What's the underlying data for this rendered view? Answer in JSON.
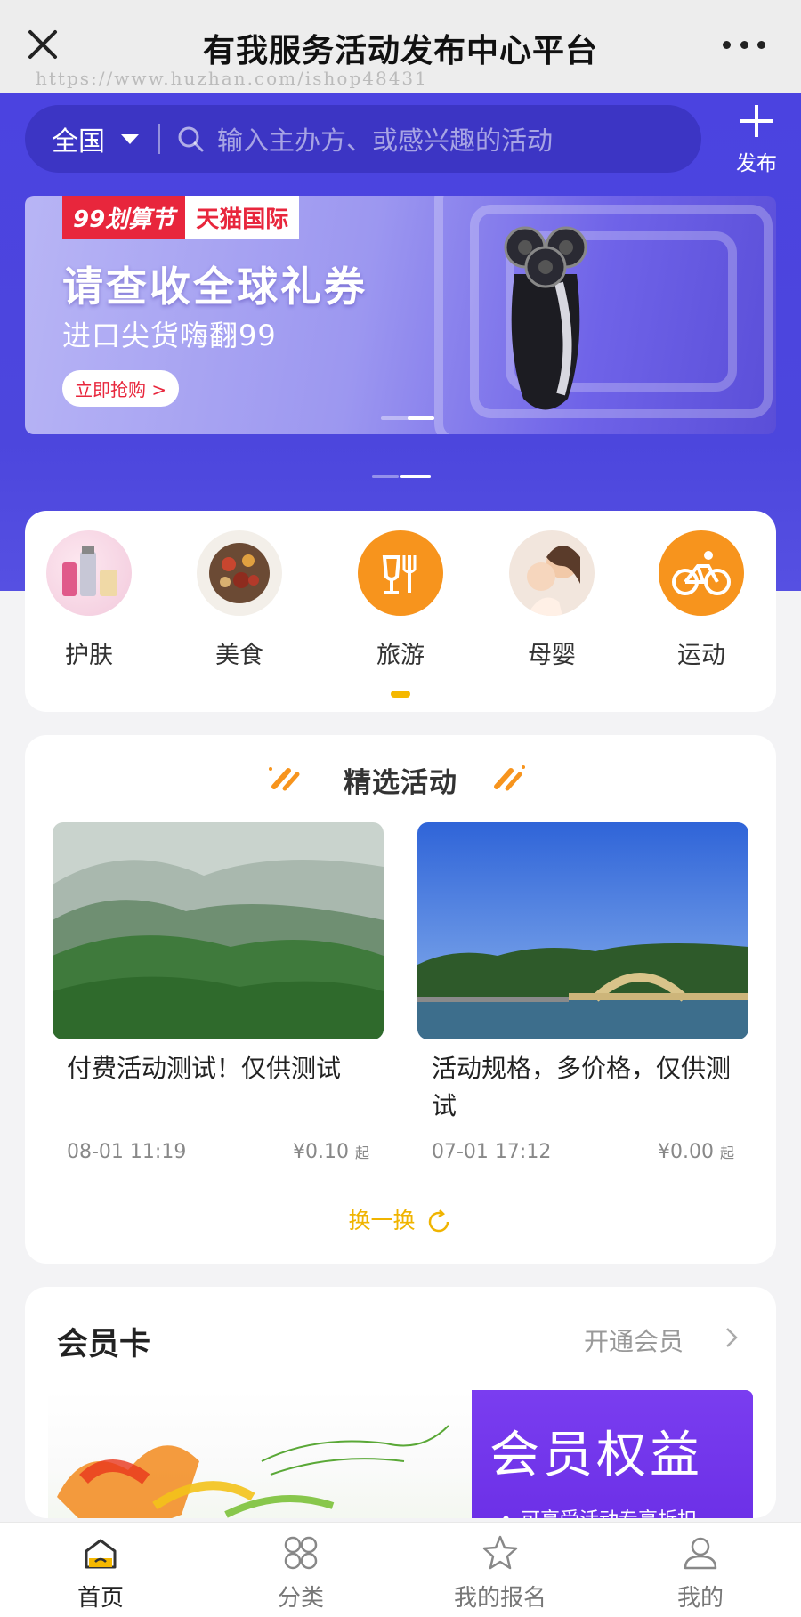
{
  "window": {
    "title": "有我服务活动发布中心平台",
    "watermark": "https://www.huzhan.com/ishop48431"
  },
  "search": {
    "region": "全国",
    "placeholder": "输入主办方、或感兴趣的活动",
    "publish_label": "发布"
  },
  "banner": {
    "tag_festival": "99划算节",
    "tag_brand": "天猫国际",
    "headline": "请查收全球礼券",
    "subline": "进口尖货嗨翻99",
    "button": "立即抢购 >"
  },
  "categories": [
    {
      "label": "护肤",
      "icon": "skincare-icon"
    },
    {
      "label": "美食",
      "icon": "food-icon"
    },
    {
      "label": "旅游",
      "icon": "travel-icon"
    },
    {
      "label": "母婴",
      "icon": "mother-baby-icon"
    },
    {
      "label": "运动",
      "icon": "bike-icon"
    }
  ],
  "featured": {
    "title": "精选活动",
    "swap_label": "换一换",
    "items": [
      {
        "title": "付费活动测试！仅供测试",
        "date": "08-01 11:19",
        "price": "¥0.10",
        "price_suffix": "起"
      },
      {
        "title": "活动规格，多价格，仅供测试",
        "date": "07-01 17:12",
        "price": "¥0.00",
        "price_suffix": "起"
      }
    ]
  },
  "member": {
    "title": "会员卡",
    "open_label": "开通会员",
    "banner_text": "会员权益",
    "banner_note": "可享受活动专享折扣"
  },
  "tabs": [
    {
      "label": "首页",
      "active": true
    },
    {
      "label": "分类",
      "active": false
    },
    {
      "label": "我的报名",
      "active": false
    },
    {
      "label": "我的",
      "active": false
    }
  ],
  "colors": {
    "header_purple": "#4b43e0",
    "accent_yellow": "#f5b800",
    "travel_orange": "#f7941d"
  }
}
